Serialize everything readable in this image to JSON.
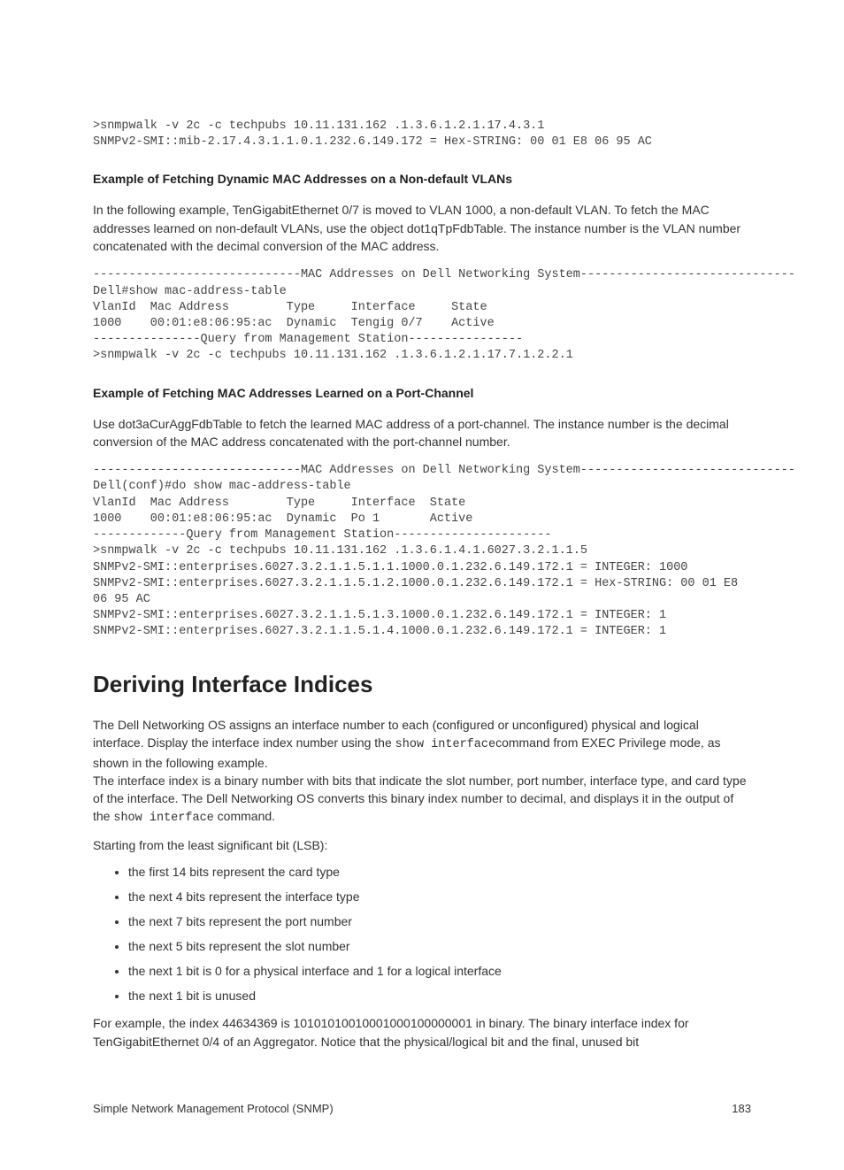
{
  "code1": ">snmpwalk -v 2c -c techpubs 10.11.131.162 .1.3.6.1.2.1.17.4.3.1\nSNMPv2-SMI::mib-2.17.4.3.1.1.0.1.232.6.149.172 = Hex-STRING: 00 01 E8 06 95 AC",
  "h3_1": "Example of Fetching Dynamic MAC Addresses on a Non-default VLANs",
  "p1": "In the following example, TenGigabitEthernet 0/7 is moved to VLAN 1000, a non-default VLAN. To fetch the MAC addresses learned on non-default VLANs, use the object dot1qTpFdbTable. The instance number is the VLAN number concatenated with the decimal conversion of the MAC address.",
  "code2": "-----------------------------MAC Addresses on Dell Networking System------------------------------\nDell#show mac-address-table\nVlanId  Mac Address        Type     Interface     State\n1000    00:01:e8:06:95:ac  Dynamic  Tengig 0/7    Active\n---------------Query from Management Station----------------\n>snmpwalk -v 2c -c techpubs 10.11.131.162 .1.3.6.1.2.1.17.7.1.2.2.1",
  "h3_2": "Example of Fetching MAC Addresses Learned on a Port-Channel",
  "p2": "Use dot3aCurAggFdbTable to fetch the learned MAC address of a port-channel. The instance number is the decimal conversion of the MAC address concatenated with the port-channel number.",
  "code3": "-----------------------------MAC Addresses on Dell Networking System------------------------------\nDell(conf)#do show mac-address-table\nVlanId  Mac Address        Type     Interface  State\n1000    00:01:e8:06:95:ac  Dynamic  Po 1       Active\n-------------Query from Management Station----------------------\n>snmpwalk -v 2c -c techpubs 10.11.131.162 .1.3.6.1.4.1.6027.3.2.1.1.5\nSNMPv2-SMI::enterprises.6027.3.2.1.1.5.1.1.1000.0.1.232.6.149.172.1 = INTEGER: 1000\nSNMPv2-SMI::enterprises.6027.3.2.1.1.5.1.2.1000.0.1.232.6.149.172.1 = Hex-STRING: 00 01 E8\n06 95 AC\nSNMPv2-SMI::enterprises.6027.3.2.1.1.5.1.3.1000.0.1.232.6.149.172.1 = INTEGER: 1\nSNMPv2-SMI::enterprises.6027.3.2.1.1.5.1.4.1000.0.1.232.6.149.172.1 = INTEGER: 1",
  "h2": "Deriving Interface Indices",
  "p3a": "The Dell Networking OS assigns an interface number to each (configured or unconfigured) physical and logical interface. Display the interface index number using the ",
  "p3code1": "show interface",
  "p3b": "command from EXEC Privilege mode, as shown in the following example.",
  "p4a": "The interface index is a binary number with bits that indicate the slot number, port number, interface type, and card type of the interface. The Dell Networking OS converts this binary index number to decimal, and displays it in the output of the ",
  "p4code1": "show interface",
  "p4b": " command.",
  "p5": "Starting from the least significant bit (LSB):",
  "li1": "the first 14 bits represent the card type",
  "li2": "the next 4 bits represent the interface type",
  "li3": "the next 7 bits represent the port number",
  "li4": "the next 5 bits represent the slot number",
  "li5": "the next 1 bit is 0 for a physical interface and 1 for a logical interface",
  "li6": "the next 1 bit is unused",
  "p6": "For example, the index 44634369 is 10101010010001000100000001 in binary. The binary interface index for TenGigabitEthernet 0/4 of an Aggregator. Notice that the physical/logical bit and the final, unused bit",
  "footer_left": "Simple Network Management Protocol (SNMP)",
  "footer_right": "183"
}
